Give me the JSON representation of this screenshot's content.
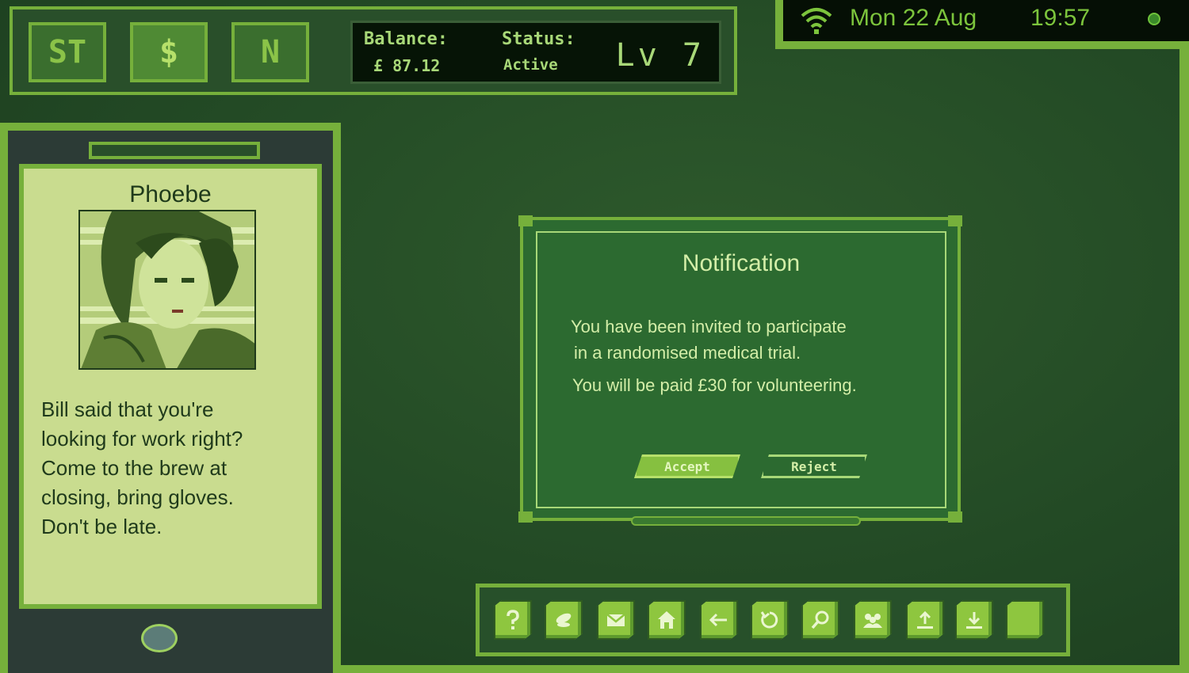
{
  "topbar": {
    "buttons": [
      {
        "label": "ST",
        "active": false
      },
      {
        "label": "$",
        "active": true
      },
      {
        "label": "N",
        "active": false
      }
    ],
    "balance_label": "Balance:",
    "balance_value": "£ 87.12",
    "status_label": "Status:",
    "status_value": "Active",
    "level": "Lv 7"
  },
  "clock": {
    "date": "Mon 22 Aug",
    "time": "19:57",
    "icons": [
      "wifi-icon",
      "status-dot-icon"
    ]
  },
  "phone": {
    "contact_name": "Phoebe",
    "message": "Bill said that you're\nlooking for work right?\nCome to the brew at\nclosing, bring gloves.\nDon't be late."
  },
  "notification": {
    "title": "Notification",
    "line1": "You have been invited to participate",
    "line2": "in a randomised medical trial.",
    "line3": "You will be paid £30 for volunteering.",
    "accept_label": "Accept",
    "reject_label": "Reject"
  },
  "toolbar": {
    "tools": [
      "help-icon",
      "pill-icon",
      "mail-icon",
      "home-icon",
      "back-arrow-icon",
      "refresh-icon",
      "search-icon",
      "group-icon",
      "upload-icon",
      "download-icon",
      "blank-icon"
    ]
  },
  "colors": {
    "accent": "#76b03b",
    "screen": "#c9dc8f",
    "panel": "#294f2a",
    "text_light": "#d4eea8"
  }
}
